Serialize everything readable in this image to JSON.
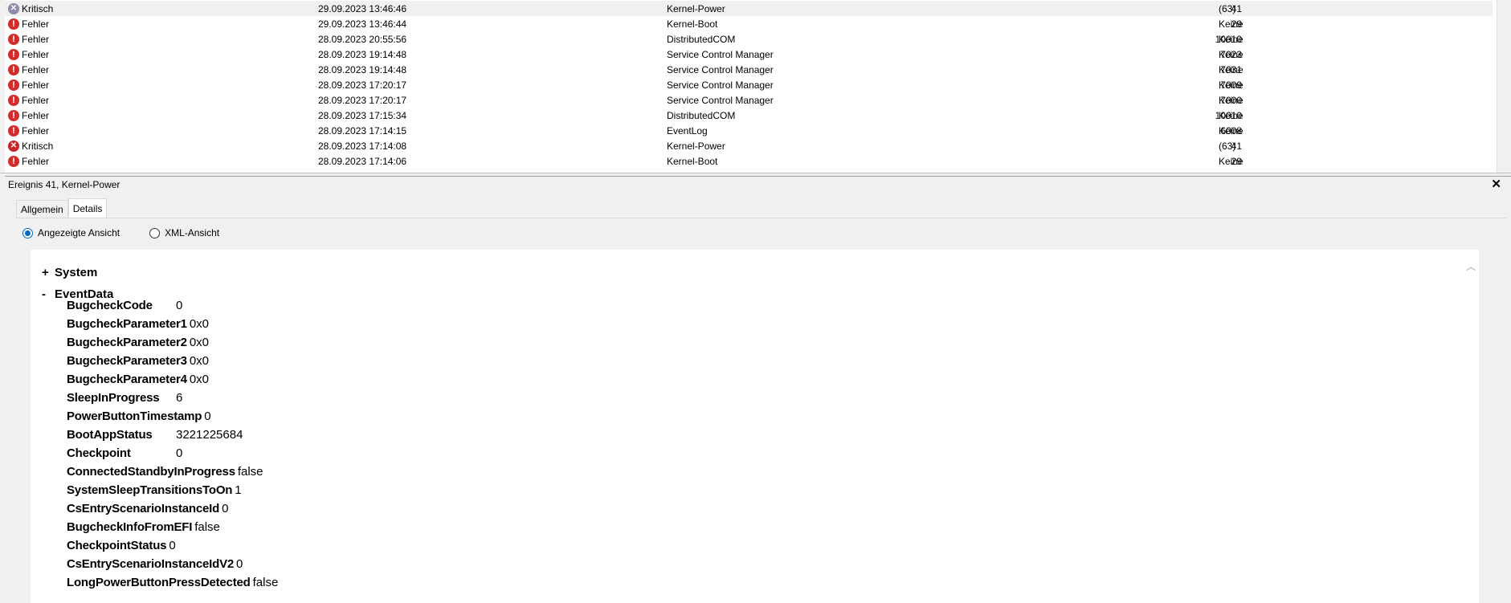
{
  "events": [
    {
      "level": "Kritisch",
      "kind": "critical",
      "date": "29.09.2023 13:46:46",
      "source": "Kernel-Power",
      "id": "41",
      "task": "(63)",
      "selected": true
    },
    {
      "level": "Fehler",
      "kind": "error",
      "date": "29.09.2023 13:46:44",
      "source": "Kernel-Boot",
      "id": "29",
      "task": "Keine"
    },
    {
      "level": "Fehler",
      "kind": "error",
      "date": "28.09.2023 20:55:56",
      "source": "DistributedCOM",
      "id": "10010",
      "task": "Keine"
    },
    {
      "level": "Fehler",
      "kind": "error",
      "date": "28.09.2023 19:14:48",
      "source": "Service Control Manager",
      "id": "7023",
      "task": "Keine"
    },
    {
      "level": "Fehler",
      "kind": "error",
      "date": "28.09.2023 19:14:48",
      "source": "Service Control Manager",
      "id": "7031",
      "task": "Keine"
    },
    {
      "level": "Fehler",
      "kind": "error",
      "date": "28.09.2023 17:20:17",
      "source": "Service Control Manager",
      "id": "7009",
      "task": "Keine"
    },
    {
      "level": "Fehler",
      "kind": "error",
      "date": "28.09.2023 17:20:17",
      "source": "Service Control Manager",
      "id": "7000",
      "task": "Keine"
    },
    {
      "level": "Fehler",
      "kind": "error",
      "date": "28.09.2023 17:15:34",
      "source": "DistributedCOM",
      "id": "10010",
      "task": "Keine"
    },
    {
      "level": "Fehler",
      "kind": "error",
      "date": "28.09.2023 17:14:15",
      "source": "EventLog",
      "id": "6008",
      "task": "Keine"
    },
    {
      "level": "Kritisch",
      "kind": "critical",
      "date": "28.09.2023 17:14:08",
      "source": "Kernel-Power",
      "id": "41",
      "task": "(63)"
    },
    {
      "level": "Fehler",
      "kind": "error",
      "date": "28.09.2023 17:14:06",
      "source": "Kernel-Boot",
      "id": "29",
      "task": "Keine"
    }
  ],
  "details": {
    "title": "Ereignis 41, Kernel-Power",
    "close_glyph": "✕",
    "tabs": [
      {
        "label": "Allgemein",
        "active": false
      },
      {
        "label": "Details",
        "active": true
      }
    ],
    "view_options": [
      {
        "label": "Angezeigte Ansicht",
        "checked": true
      },
      {
        "label": "XML-Ansicht",
        "checked": false
      }
    ],
    "nodes": [
      {
        "toggle": "+",
        "label": "System"
      },
      {
        "toggle": "-",
        "label": "EventData"
      }
    ],
    "event_data": [
      {
        "key": "BugcheckCode",
        "value": "0",
        "aligned": true
      },
      {
        "key": "BugcheckParameter1",
        "value": "0x0",
        "aligned": false
      },
      {
        "key": "BugcheckParameter2",
        "value": "0x0",
        "aligned": false
      },
      {
        "key": "BugcheckParameter3",
        "value": "0x0",
        "aligned": false
      },
      {
        "key": "BugcheckParameter4",
        "value": "0x0",
        "aligned": false
      },
      {
        "key": "SleepInProgress",
        "value": "6",
        "aligned": true
      },
      {
        "key": "PowerButtonTimestamp",
        "value": "0",
        "aligned": false
      },
      {
        "key": "BootAppStatus",
        "value": "3221225684",
        "aligned": true
      },
      {
        "key": "Checkpoint",
        "value": "0",
        "aligned": true
      },
      {
        "key": "ConnectedStandbyInProgress",
        "value": "false",
        "aligned": false
      },
      {
        "key": "SystemSleepTransitionsToOn",
        "value": "1",
        "aligned": false
      },
      {
        "key": "CsEntryScenarioInstanceId",
        "value": "0",
        "aligned": false
      },
      {
        "key": "BugcheckInfoFromEFI",
        "value": "false",
        "aligned": false
      },
      {
        "key": "CheckpointStatus",
        "value": "0",
        "aligned": false
      },
      {
        "key": "CsEntryScenarioInstanceIdV2",
        "value": "0",
        "aligned": false
      },
      {
        "key": "LongPowerButtonPressDetected",
        "value": "false",
        "aligned": false
      }
    ]
  }
}
